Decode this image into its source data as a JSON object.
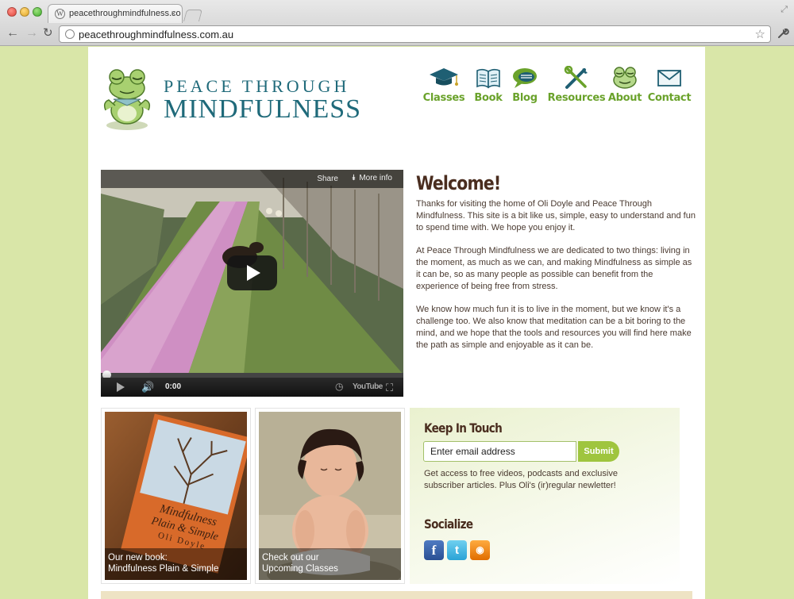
{
  "browser": {
    "tab_title": "peacethroughmindfulness.co",
    "tab_close": "×",
    "url": "peacethroughmindfulness.com.au",
    "back": "←",
    "forward": "→",
    "reload": "↻",
    "star": "☆",
    "wrench": "🔧",
    "resize": "⤢"
  },
  "logo": {
    "line1": "PEACE THROUGH",
    "line2": "MINDFULNESS"
  },
  "nav": [
    {
      "label": "Classes"
    },
    {
      "label": "Book"
    },
    {
      "label": "Blog"
    },
    {
      "label": "Resources"
    },
    {
      "label": "About"
    },
    {
      "label": "Contact"
    }
  ],
  "video": {
    "share": "Share",
    "more_info": "More info",
    "time": "0:00",
    "brand": "YouTube",
    "progress": 0
  },
  "welcome": {
    "title": "Welcome!",
    "paragraphs": [
      "Thanks for visiting the home of Oli Doyle and Peace Through Mindfulness. This site is a bit like us, simple, easy to understand and fun to spend time with. We hope you enjoy it.",
      "At Peace Through Mindfulness we are dedicated to two things: living in the moment, as much as we can, and making Mindfulness as simple as it can be, so as many people as possible can benefit from the experience of being free from stress.",
      "We know how much fun it is to live in the moment, but we know it's a challenge too. We also know that meditation can be a bit boring to the mind, and we hope that the tools and resources you will find here make the path as simple and enjoyable as it can be."
    ]
  },
  "promos": {
    "book": {
      "caption_line1": "Our new book:",
      "caption_line2": "Mindfulness Plain & Simple",
      "cover_title1": "Mindfulness",
      "cover_title2": "Plain & Simple",
      "cover_author": "Oli Doyle"
    },
    "classes": {
      "caption_line1": "Check out our",
      "caption_line2": "Upcoming Classes"
    }
  },
  "keep_in_touch": {
    "title": "Keep In Touch",
    "email_value": "Enter email address",
    "submit": "Submit",
    "description": "Get access to free videos, podcasts and exclusive subscriber articles. Plus Oli's (ir)regular newletter!",
    "socialize_title": "Socialize",
    "social": {
      "facebook": "f",
      "twitter": "t",
      "rss": "◉"
    }
  },
  "colors": {
    "background": "#d9e6a8",
    "logo_teal": "#1f6a7a",
    "nav_green": "#6aa22b",
    "heading_brown": "#4a2d1f",
    "submit_green": "#9fc53e"
  }
}
